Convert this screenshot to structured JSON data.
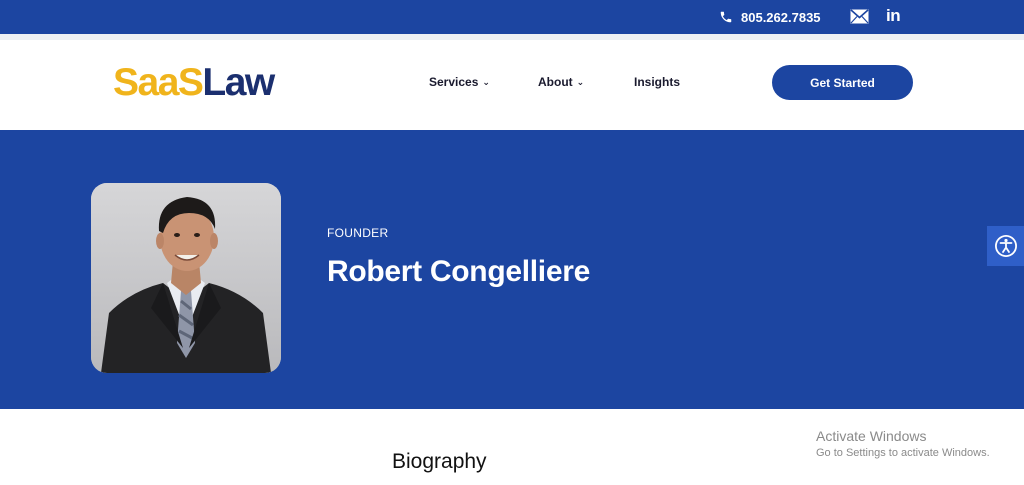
{
  "topbar": {
    "phone": "805.262.7835",
    "phone_icon": "phone-icon",
    "mail_icon": "mail-icon",
    "linkedin_label": "in",
    "linkedin_icon": "linkedin-icon"
  },
  "header": {
    "logo_part1": "SaaS",
    "logo_part2": "Law",
    "nav": [
      {
        "label": "Services",
        "has_dropdown": true
      },
      {
        "label": "About",
        "has_dropdown": true
      },
      {
        "label": "Insights",
        "has_dropdown": false
      }
    ],
    "cta_label": "Get Started"
  },
  "hero": {
    "role": "FOUNDER",
    "name": "Robert Congelliere"
  },
  "accessibility": {
    "icon": "accessibility-icon"
  },
  "content": {
    "heading": "Biography"
  },
  "watermark": {
    "line1": "Activate Windows",
    "line2": "Go to Settings to activate Windows."
  },
  "colors": {
    "brand_blue": "#1c45a1",
    "logo_yellow": "#f0b41c",
    "logo_navy": "#1b2f6f"
  }
}
